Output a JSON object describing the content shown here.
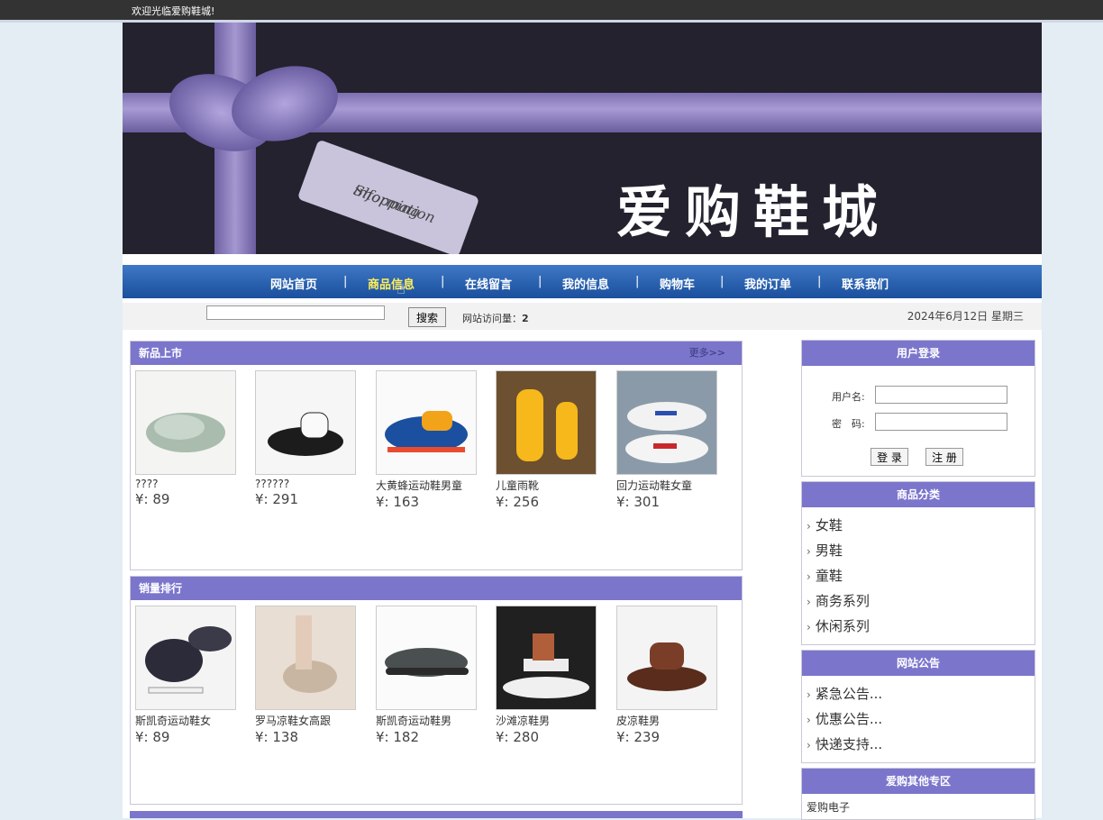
{
  "topbar": {
    "welcome": "欢迎光临爱购鞋城!"
  },
  "banner": {
    "title": "爱购鞋城",
    "tag_text_1": "Shopping",
    "tag_text_2": "information"
  },
  "nav": {
    "items": [
      "网站首页",
      "商品信息",
      "在线留言",
      "我的信息",
      "购物车",
      "我的订单",
      "联系我们"
    ],
    "separator": "|",
    "active_index": 1
  },
  "search": {
    "input_value": "",
    "button_label": "搜索",
    "visits_label": "网站访问量：",
    "visits_count": "2",
    "date": "2024年6月12日 星期三"
  },
  "new_products": {
    "title": "新品上市",
    "more": "更多>>",
    "items": [
      {
        "name": "????",
        "price": "¥: 89"
      },
      {
        "name": "??????",
        "price": "¥: 291"
      },
      {
        "name": "大黄蜂运动鞋男童",
        "price": "¥: 163"
      },
      {
        "name": "儿童雨靴",
        "price": "¥: 256"
      },
      {
        "name": "回力运动鞋女童",
        "price": "¥: 301"
      }
    ]
  },
  "bestsellers": {
    "title": "销量排行",
    "items": [
      {
        "name": "斯凯奇运动鞋女",
        "price": "¥:  89"
      },
      {
        "name": "罗马凉鞋女高跟",
        "price": "¥:  138"
      },
      {
        "name": "斯凯奇运动鞋男",
        "price": "¥:  182"
      },
      {
        "name": "沙滩凉鞋男",
        "price": "¥:  280"
      },
      {
        "name": "皮凉鞋男",
        "price": "¥:  239"
      }
    ]
  },
  "login": {
    "title": "用户登录",
    "username_label": "用户名:",
    "password_label": "密　码:",
    "login_button": "登 录",
    "register_button": "注 册"
  },
  "categories": {
    "title": "商品分类",
    "items": [
      "女鞋",
      "男鞋",
      "童鞋",
      "商务系列",
      "休闲系列"
    ]
  },
  "notices": {
    "title": "网站公告",
    "items": [
      "紧急公告...",
      "优惠公告...",
      "快递支持..."
    ]
  },
  "other": {
    "title": "爱购其他专区",
    "items": [
      "爱购电子"
    ]
  },
  "colors": {
    "panel_header": "#7b75cc",
    "nav": "#1a4f9c",
    "active_nav": "#ffef5b"
  }
}
